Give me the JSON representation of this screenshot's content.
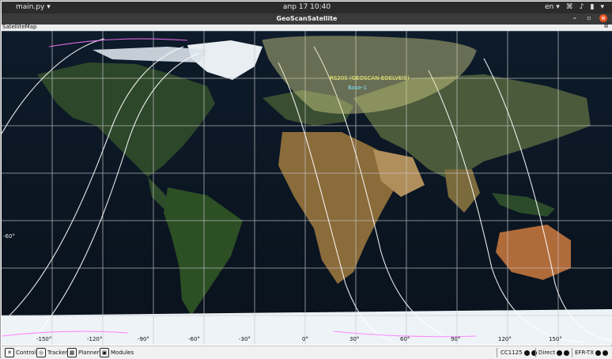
{
  "topbar": {
    "app_menu": "main.py ▾",
    "datetime": "апр 17  10:40",
    "lang": "en ▾",
    "tray_icons": [
      "network-icon",
      "volume-icon",
      "battery-icon",
      "system-menu-icon"
    ]
  },
  "window": {
    "title": "GeoScanSatellite",
    "minimize": "–",
    "maximize": "▫",
    "close": "×"
  },
  "panel": {
    "title": "SatelliteMap",
    "undock": "⧉"
  },
  "map": {
    "satellite_label": "RS20S (GEOSCAN-EDELVEIS)",
    "station_label": "Base-1",
    "lat_label": "-60°",
    "lon_labels": [
      "-150°",
      "-120°",
      "-90°",
      "-60°",
      "-30°",
      "0°",
      "30°",
      "60°",
      "90°",
      "120°",
      "150°"
    ],
    "colors": {
      "footprint": "#d8d58b",
      "track": "#ffffff",
      "track2": "#ff77ff",
      "grid": "#c9c9c9"
    }
  },
  "bottombar": {
    "tabs": [
      {
        "label": "Control",
        "icon": "control-icon"
      },
      {
        "label": "Tracker",
        "icon": "tracker-icon"
      },
      {
        "label": "Planner",
        "icon": "planner-icon"
      },
      {
        "label": "Modules",
        "icon": "modules-icon"
      }
    ],
    "status": [
      {
        "label": "CC1125"
      },
      {
        "label": "Direct"
      },
      {
        "label": "EFR-TX"
      }
    ]
  }
}
